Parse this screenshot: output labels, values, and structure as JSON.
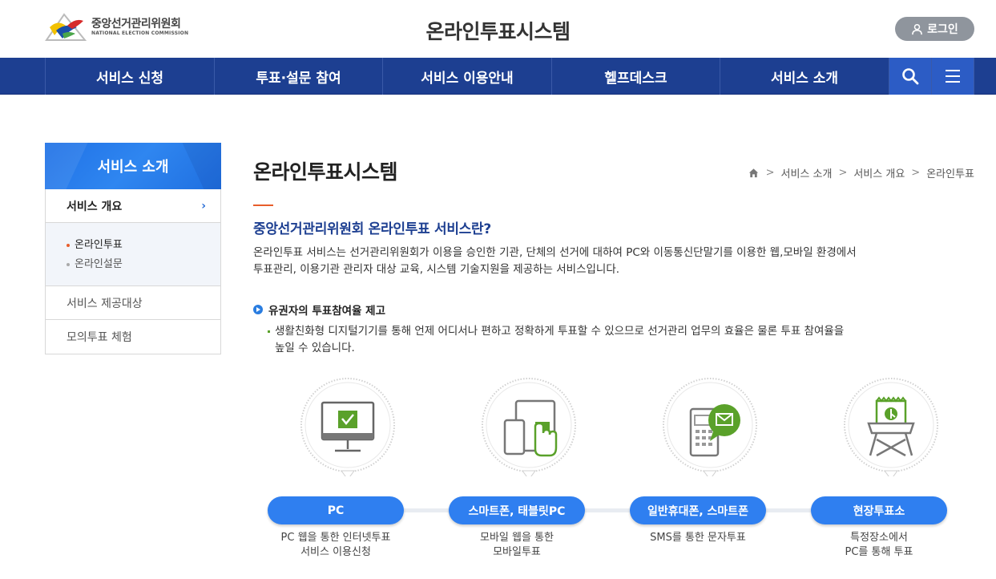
{
  "header": {
    "logo_ko": "중앙선거관리위원회",
    "logo_en": "NATIONAL ELECTION COMMISSION",
    "site_title": "온라인투표시스템",
    "login_label": "로그인"
  },
  "gnb": {
    "items": [
      "서비스 신청",
      "투표·설문 참여",
      "서비스 이용안내",
      "헬프데스크",
      "서비스 소개"
    ],
    "search_icon": "search-icon",
    "menu_icon": "hamburger-icon"
  },
  "lnb": {
    "title": "서비스 소개",
    "active": "서비스 개요",
    "sub_items": [
      "온라인투표",
      "온라인설문"
    ],
    "items": [
      "서비스 제공대상",
      "모의투표 체험"
    ]
  },
  "content": {
    "title": "온라인투표시스템",
    "breadcrumb": [
      "서비스 소개",
      "서비스 개요",
      "온라인투표"
    ],
    "section_title": "중앙선거관리위원회 온라인투표 서비스란?",
    "desc_line1": "온라인투표 서비스는 선거관리위원회가 이용을 승인한 기관, 단체의 선거에 대하여 PC와 이동통신단말기를 이용한 웹,모바일 환경에서",
    "desc_line2": "투표관리, 이용기관 관리자 대상 교육, 시스템 기술지원을 제공하는 서비스입니다.",
    "bullet_title": "유권자의 투표참여율 제고",
    "bullet_line1": "생활친화형 디지털기기를 통해 언제 어디서나 편하고 정확하게 투표할 수 있으므로 선거관리 업무의 효율은 물론 투표 참여율을",
    "bullet_line2": "높일 수 있습니다."
  },
  "services": [
    {
      "label": "PC",
      "cap1": "PC 웹을 통한 인터넷투표",
      "cap2": "서비스 이용신청",
      "icon": "monitor-check-icon"
    },
    {
      "label": "스마트폰, 태블릿PC",
      "cap1": "모바일 웹을 통한",
      "cap2": "모바일투표",
      "icon": "touch-device-icon"
    },
    {
      "label": "일반휴대폰, 스마트폰",
      "cap1": "SMS를 통한 문자투표",
      "cap2": "",
      "icon": "phone-message-icon"
    },
    {
      "label": "현장투표소",
      "cap1": "특정장소에서",
      "cap2": "PC를 통해 투표",
      "icon": "voting-booth-icon"
    }
  ],
  "colors": {
    "nav_bg": "#1d3f91",
    "accent_blue": "#2f7ff0",
    "accent_green": "#5aa12a",
    "accent_orange": "#e85d2b",
    "title_blue": "#1d3f91"
  }
}
